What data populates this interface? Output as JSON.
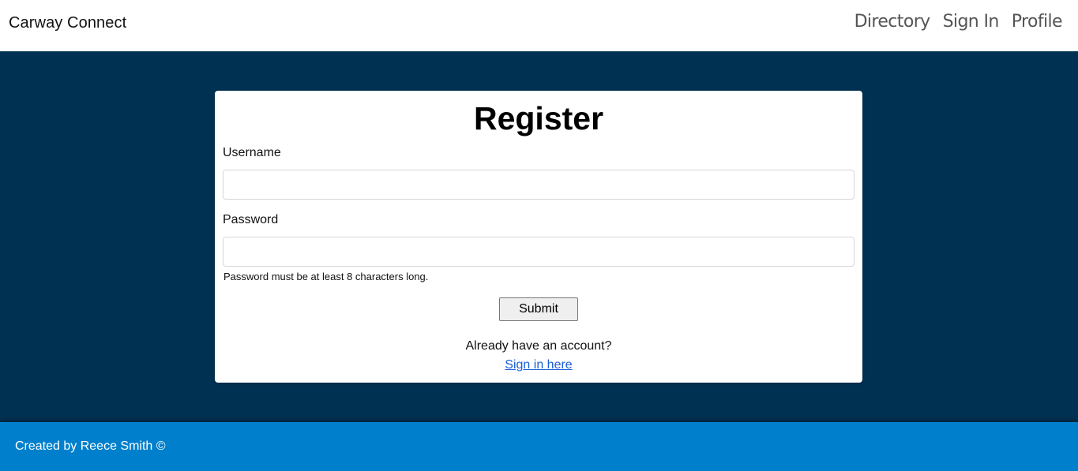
{
  "header": {
    "brand": "Carway Connect",
    "nav": [
      "Directory",
      "Sign In",
      "Profile"
    ]
  },
  "form": {
    "title": "Register",
    "username_label": "Username",
    "username_value": "",
    "password_label": "Password",
    "password_value": "",
    "password_hint": "Password must be at least 8 characters long.",
    "submit_label": "Submit",
    "already_text": "Already have an account?",
    "signin_link": "Sign in here"
  },
  "footer": {
    "text": "Created by Reece Smith ©"
  },
  "colors": {
    "page_bg": "#003152",
    "footer_bg": "#0080cc",
    "link": "#1a5ed8"
  }
}
